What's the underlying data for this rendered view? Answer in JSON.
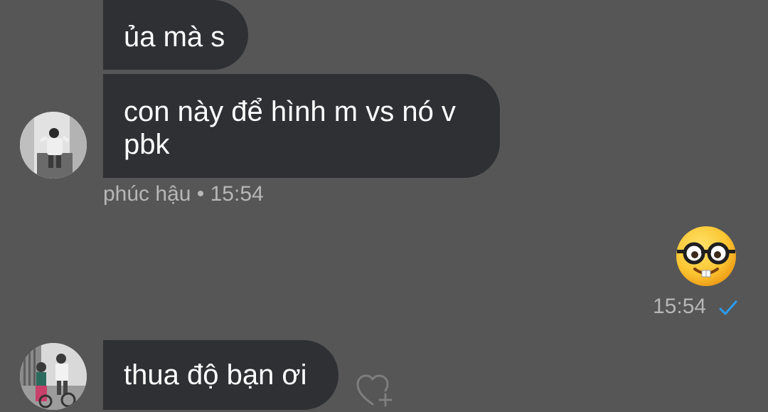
{
  "messages": [
    {
      "sender": "other",
      "lines": [
        "ủa mà s"
      ]
    },
    {
      "sender": "other",
      "lines": [
        "con này để hình m vs nó v",
        "pbk"
      ]
    },
    {
      "sender": "other",
      "lines": [
        "thua độ bạn ơi"
      ]
    }
  ],
  "meta_other": "phúc hậu • 15:54",
  "sent_message": {
    "emoji": "nerd-face-emoji",
    "time": "15:54",
    "status_icon": "check-icon"
  },
  "icons": {
    "like": "heart-plus-icon"
  },
  "colors": {
    "background": "#565656",
    "bubble": "#2e3033",
    "meta_text": "#b7b7b7",
    "check": "#2b9cf2"
  }
}
